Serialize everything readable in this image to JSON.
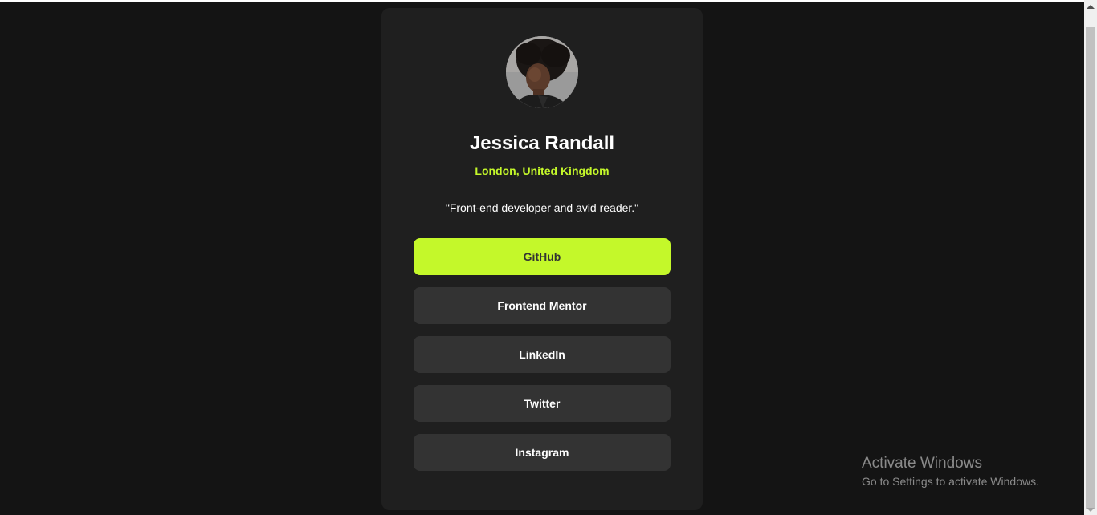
{
  "profile": {
    "name": "Jessica Randall",
    "location": "London, United Kingdom",
    "bio": "\"Front-end developer and avid reader.\""
  },
  "links": [
    {
      "label": "GitHub",
      "active": true
    },
    {
      "label": "Frontend Mentor",
      "active": false
    },
    {
      "label": "LinkedIn",
      "active": false
    },
    {
      "label": "Twitter",
      "active": false
    },
    {
      "label": "Instagram",
      "active": false
    }
  ],
  "watermark": {
    "title": "Activate Windows",
    "subtitle": "Go to Settings to activate Windows."
  },
  "colors": {
    "page_bg": "#141414",
    "card_bg": "#1f1f1f",
    "accent": "#c4f82a",
    "button_bg": "#333333"
  }
}
